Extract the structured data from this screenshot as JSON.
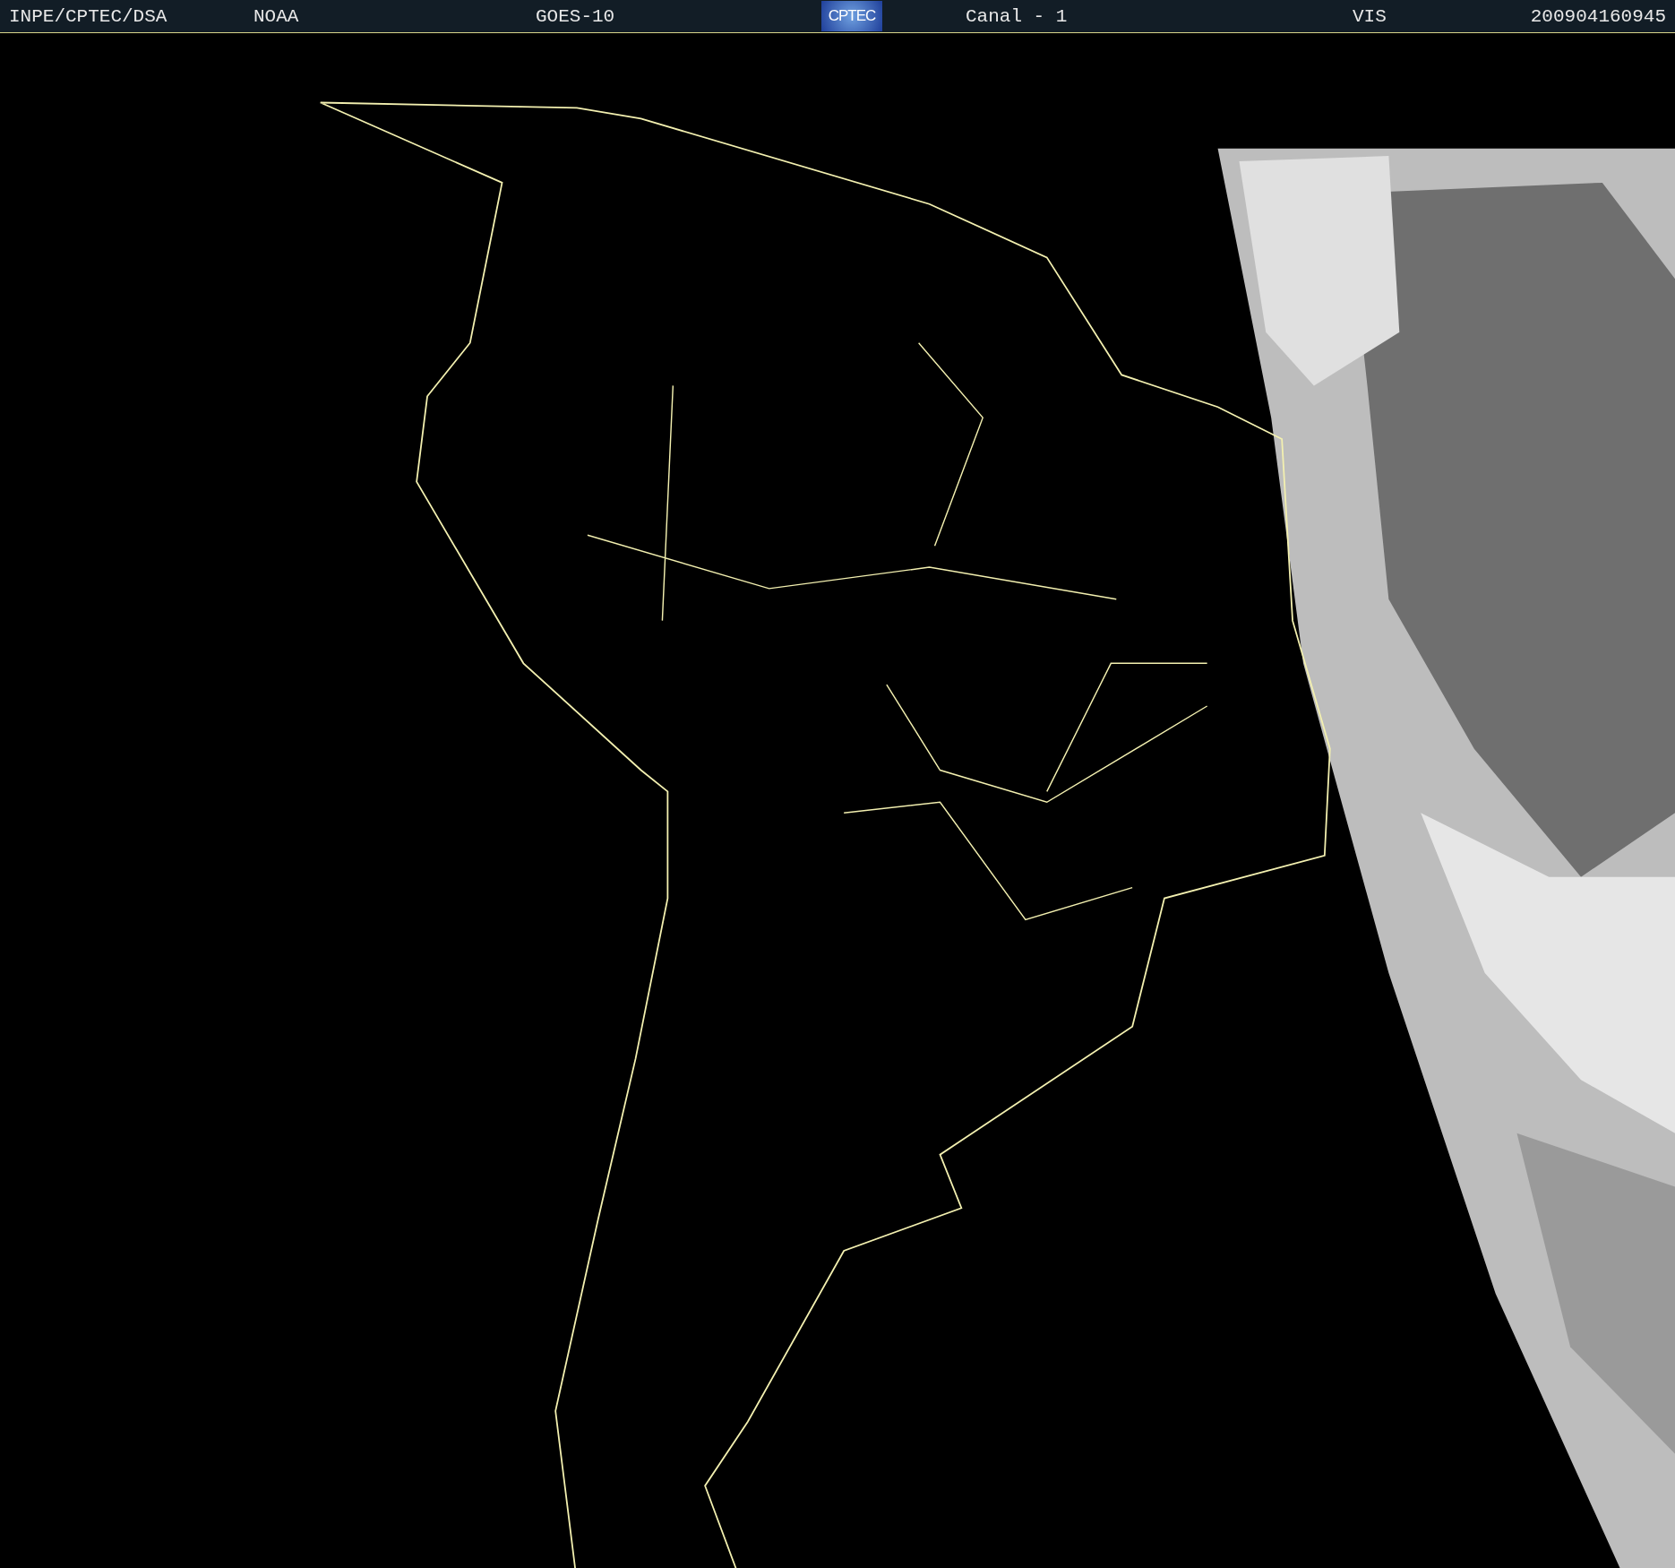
{
  "header": {
    "agency": "INPE/CPTEC/DSA",
    "provider": "NOAA",
    "satellite": "GOES-10",
    "logo": "CPTEC",
    "channel": "Canal - 1",
    "band": "VIS",
    "timestamp": "200904160945"
  }
}
